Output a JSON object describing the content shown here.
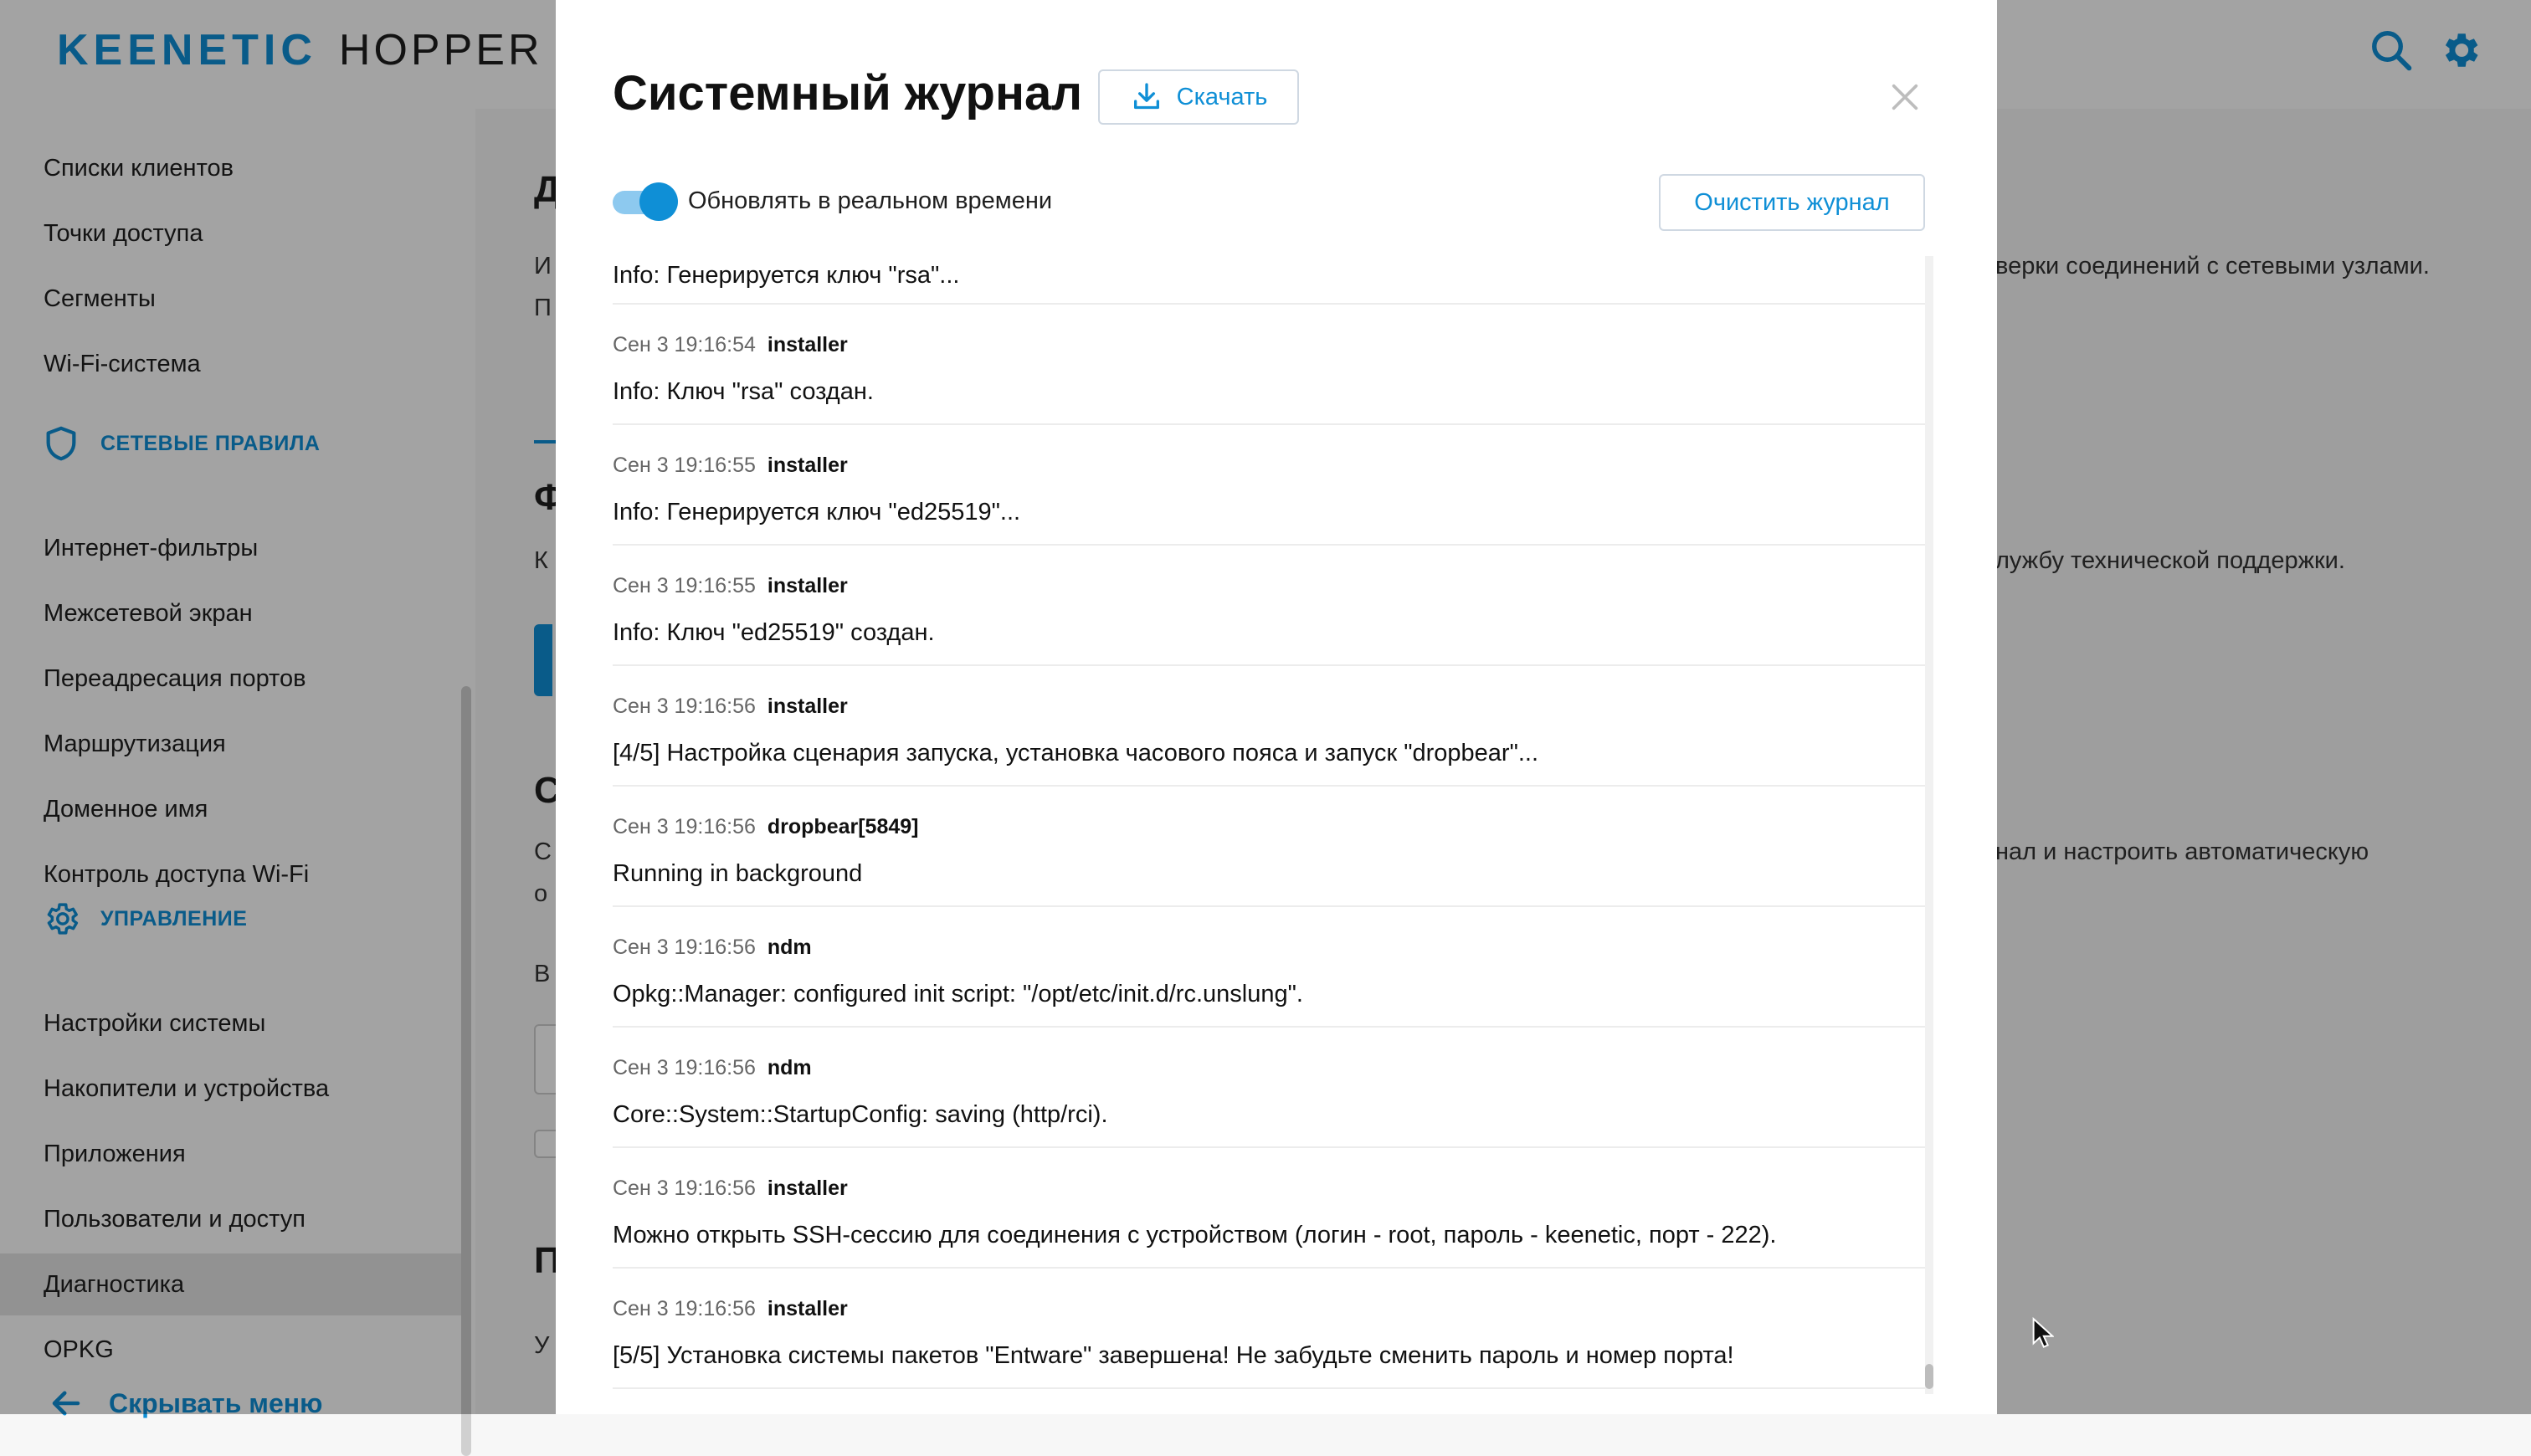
{
  "app": {
    "brand_part1": "KEENETIC",
    "brand_part2": "HOPPER",
    "colors": {
      "accent": "#0f8fd6",
      "active_bg": "#e5e5e5",
      "overlay": "rgba(0,0,0,0.36)"
    }
  },
  "header": {
    "search_icon": "search-icon",
    "settings_icon": "gear-icon"
  },
  "sidebar": {
    "items_top": [
      "Списки клиентов",
      "Точки доступа",
      "Сегменты",
      "Wi-Fi-система"
    ],
    "section_network": "СЕТЕВЫЕ ПРАВИЛА",
    "items_network": [
      "Интернет-фильтры",
      "Межсетевой экран",
      "Переадресация портов",
      "Маршрутизация",
      "Доменное имя",
      "Контроль доступа Wi-Fi"
    ],
    "section_management": "УПРАВЛЕНИЕ",
    "items_management": [
      "Настройки системы",
      "Накопители и устройства",
      "Приложения",
      "Пользователи и доступ",
      "Диагностика",
      "OPKG"
    ],
    "active_item": "Диагностика",
    "hide_menu": "Скрывать меню"
  },
  "background": {
    "frag_1": "верки соединений с сетевыми узлами.",
    "frag_2": "лужбу технической поддержки.",
    "frag_3": "нал и настроить автоматическую",
    "h1": "Д",
    "h2": "Ф",
    "h3": "С",
    "h4": "П",
    "p1": "И",
    "p2": "П",
    "p3": "К",
    "p4": "С",
    "p5": "о",
    "p6": "В",
    "p7": "У"
  },
  "modal": {
    "title": "Системный журнал",
    "download_label": "Скачать",
    "clear_label": "Очистить журнал",
    "realtime_label": "Обновлять в реальном времени",
    "realtime_on": true,
    "first_line": "Info: Генерируется ключ \"rsa\"...",
    "entries": [
      {
        "time": "Сен 3 19:16:54",
        "source": "installer",
        "message": "Info: Ключ \"rsa\" создан."
      },
      {
        "time": "Сен 3 19:16:55",
        "source": "installer",
        "message": "Info: Генерируется ключ \"ed25519\"..."
      },
      {
        "time": "Сен 3 19:16:55",
        "source": "installer",
        "message": "Info: Ключ \"ed25519\" создан."
      },
      {
        "time": "Сен 3 19:16:56",
        "source": "installer",
        "message": "[4/5] Настройка сценария запуска, установка часового пояса и запуск \"dropbear\"..."
      },
      {
        "time": "Сен 3 19:16:56",
        "source": "dropbear[5849]",
        "message": "Running in background"
      },
      {
        "time": "Сен 3 19:16:56",
        "source": "ndm",
        "message": "Opkg::Manager: configured init script: \"/opt/etc/init.d/rc.unslung\"."
      },
      {
        "time": "Сен 3 19:16:56",
        "source": "ndm",
        "message": "Core::System::StartupConfig: saving (http/rci)."
      },
      {
        "time": "Сен 3 19:16:56",
        "source": "installer",
        "message": "Можно открыть SSH-сессию для соединения с устройством (логин - root, пароль - keenetic, порт - 222)."
      },
      {
        "time": "Сен 3 19:16:56",
        "source": "installer",
        "message": "[5/5] Установка системы пакетов \"Entware\" завершена! Не забудьте сменить пароль и номер порта!"
      }
    ]
  }
}
